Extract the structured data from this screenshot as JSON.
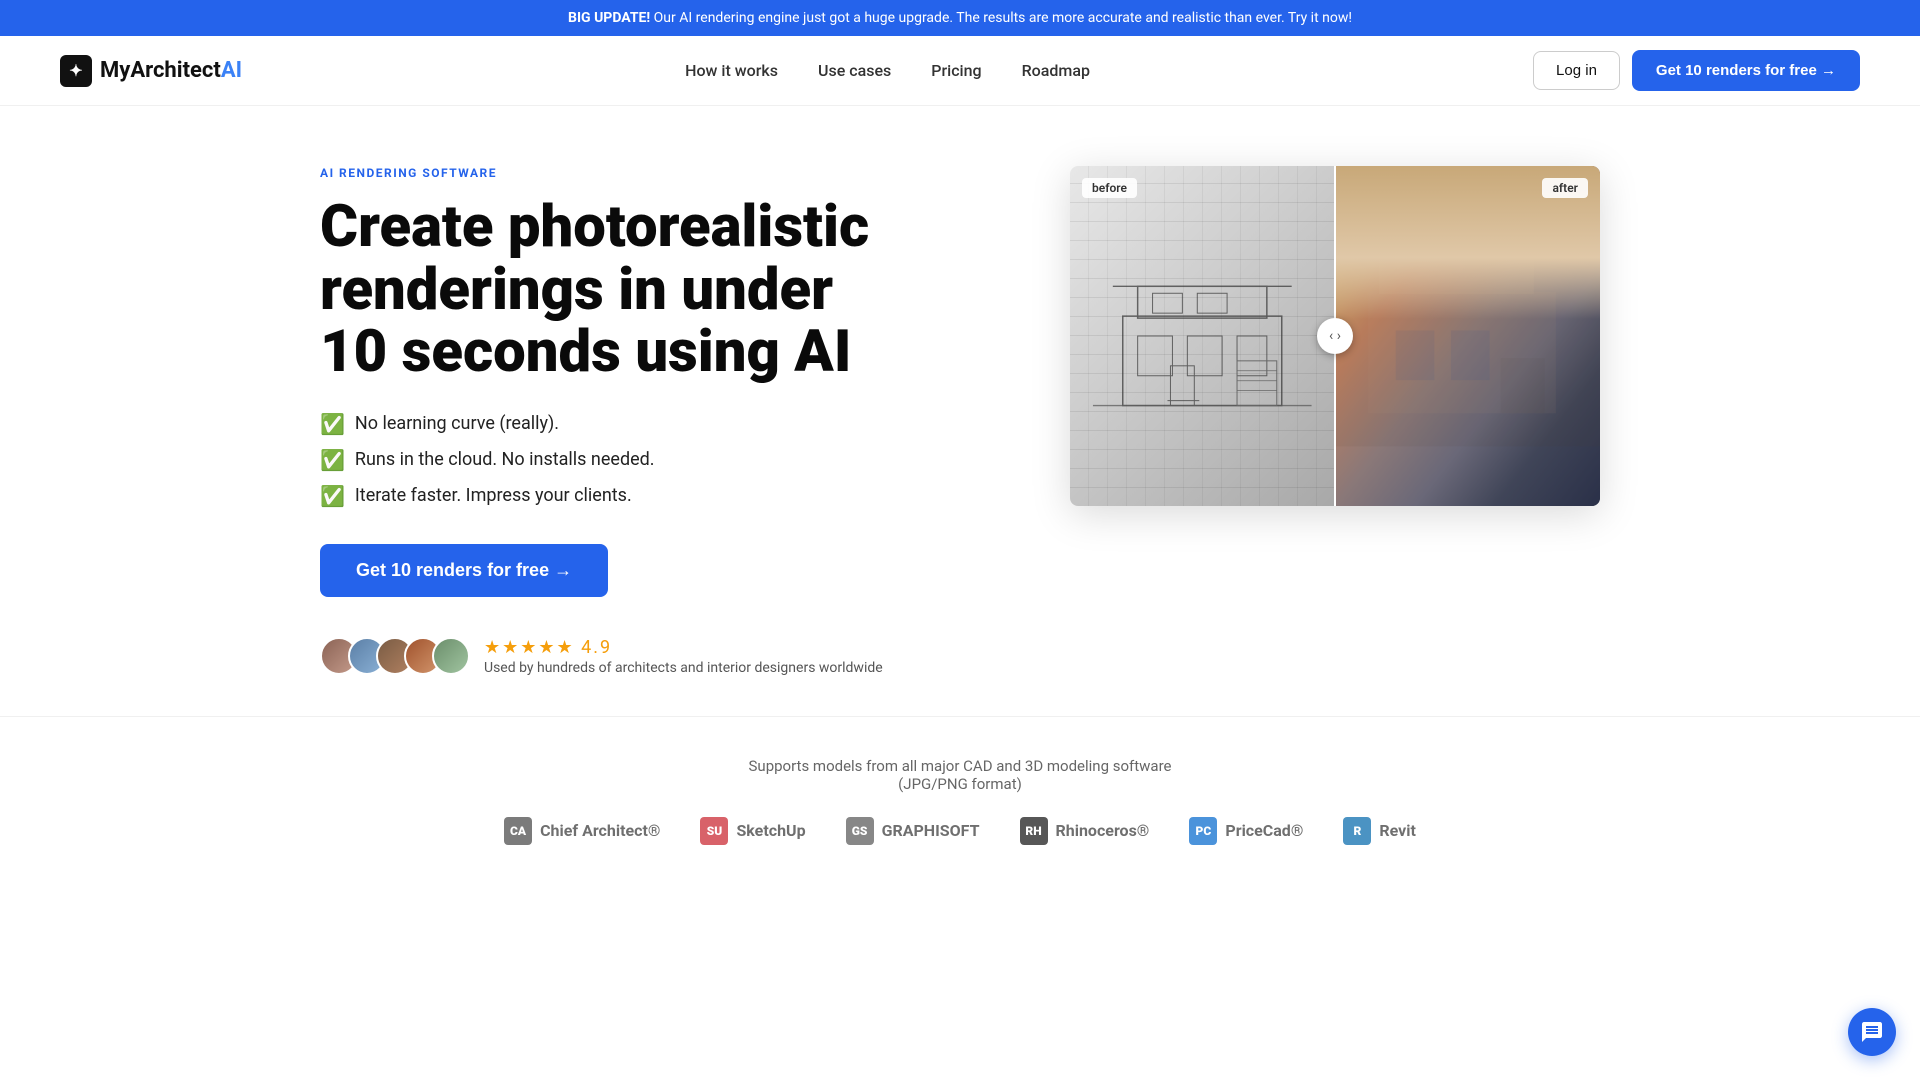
{
  "announcement": {
    "bold": "BIG UPDATE!",
    "text": " Our AI rendering engine just got a huge upgrade. The results are more accurate and realistic than ever. Try it now!"
  },
  "nav": {
    "logo_text": "MyArchitect",
    "logo_ai": "AI",
    "logo_icon": "✦",
    "links": [
      {
        "label": "How it works",
        "href": "#"
      },
      {
        "label": "Use cases",
        "href": "#"
      },
      {
        "label": "Pricing",
        "href": "#"
      },
      {
        "label": "Roadmap",
        "href": "#"
      }
    ],
    "login_label": "Log in",
    "cta_label": "Get 10 renders for free →"
  },
  "hero": {
    "badge": "AI RENDERING SOFTWARE",
    "title": "Create photorealistic renderings in under 10 seconds using AI",
    "features": [
      "No learning curve (really).",
      "Runs in the cloud. No installs needed.",
      "Iterate faster. Impress your clients."
    ],
    "cta_label": "Get 10 renders for free →",
    "rating": "4.9",
    "rating_text": "Used by hundreds of architects and interior designers worldwide",
    "image_label_before": "before",
    "image_label_after": "after"
  },
  "supports": {
    "text": "Supports models from all major CAD and 3D modeling software",
    "subtext": "(JPG/PNG format)",
    "logos": [
      {
        "name": "Chief Architect®",
        "icon": "CA",
        "color": "#444"
      },
      {
        "name": "SketchUp",
        "icon": "SU",
        "color": "#c8202a"
      },
      {
        "name": "Graphisoft",
        "icon": "GS",
        "color": "#555"
      },
      {
        "name": "Rhinoceros®",
        "icon": "RH",
        "color": "#111"
      },
      {
        "name": "PriceCad®",
        "icon": "PC",
        "color": "#0066cc"
      },
      {
        "name": "Revit",
        "icon": "R",
        "color": "#0066aa"
      }
    ]
  }
}
